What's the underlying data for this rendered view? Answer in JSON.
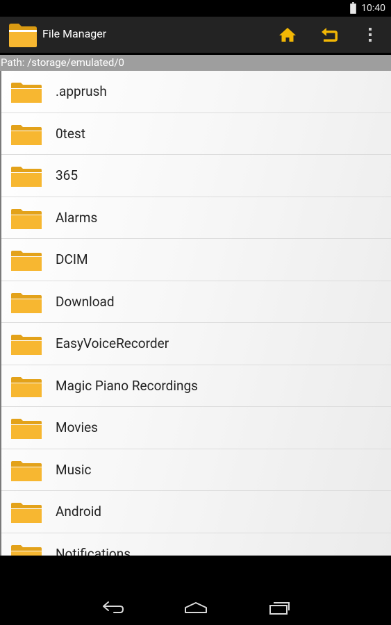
{
  "status_bar": {
    "time": "10:40"
  },
  "action_bar": {
    "title": "File Manager"
  },
  "path_bar": {
    "text": "Path: /storage/emulated/0"
  },
  "files": [
    {
      "name": ".apprush"
    },
    {
      "name": "0test"
    },
    {
      "name": "365"
    },
    {
      "name": "Alarms"
    },
    {
      "name": "DCIM"
    },
    {
      "name": "Download"
    },
    {
      "name": "EasyVoiceRecorder"
    },
    {
      "name": "Magic Piano Recordings"
    },
    {
      "name": "Movies"
    },
    {
      "name": "Music"
    },
    {
      "name": "Android"
    },
    {
      "name": "Notifications"
    }
  ],
  "icons": {
    "app": "folder-icon",
    "home": "home-icon",
    "up": "return-icon",
    "overflow": "overflow-menu-icon",
    "nav_back": "back-icon",
    "nav_home": "nav-home-icon",
    "nav_recents": "recents-icon"
  },
  "colors": {
    "action_bar": "#232323",
    "folder": "#f7b731",
    "accent_icon": "#f2b705",
    "path_bar": "#9e9e9e"
  }
}
